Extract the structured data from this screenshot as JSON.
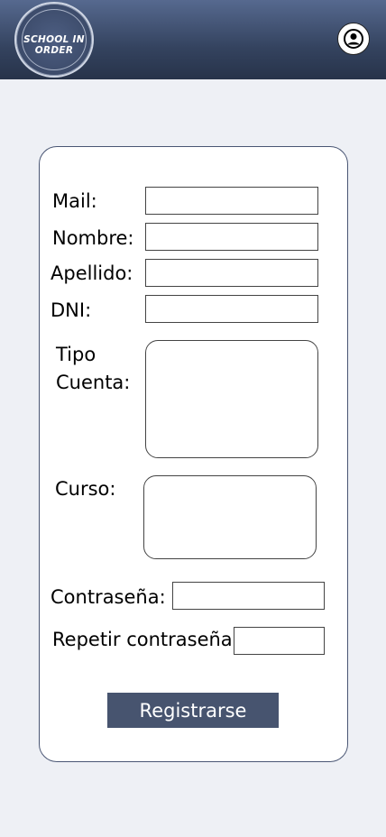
{
  "header": {
    "logo_text": "SCHOOL IN ORDER",
    "profile_icon": "user-circle-icon"
  },
  "form": {
    "mail_label": "Mail:",
    "nombre_label": "Nombre:",
    "apellido_label": "Apellido:",
    "dni_label": "DNI:",
    "tipo_label_1": "Tipo",
    "tipo_label_2": "Cuenta:",
    "curso_label": "Curso:",
    "contrasena_label": "Contraseña:",
    "repetir_label": "Repetir contraseña:",
    "mail_value": "",
    "nombre_value": "",
    "apellido_value": "",
    "dni_value": "",
    "contrasena_value": "",
    "repetir_value": "",
    "submit_label": "Registrarse"
  },
  "colors": {
    "header": "#34435f",
    "button": "#47546f",
    "background": "#eef0f5"
  }
}
